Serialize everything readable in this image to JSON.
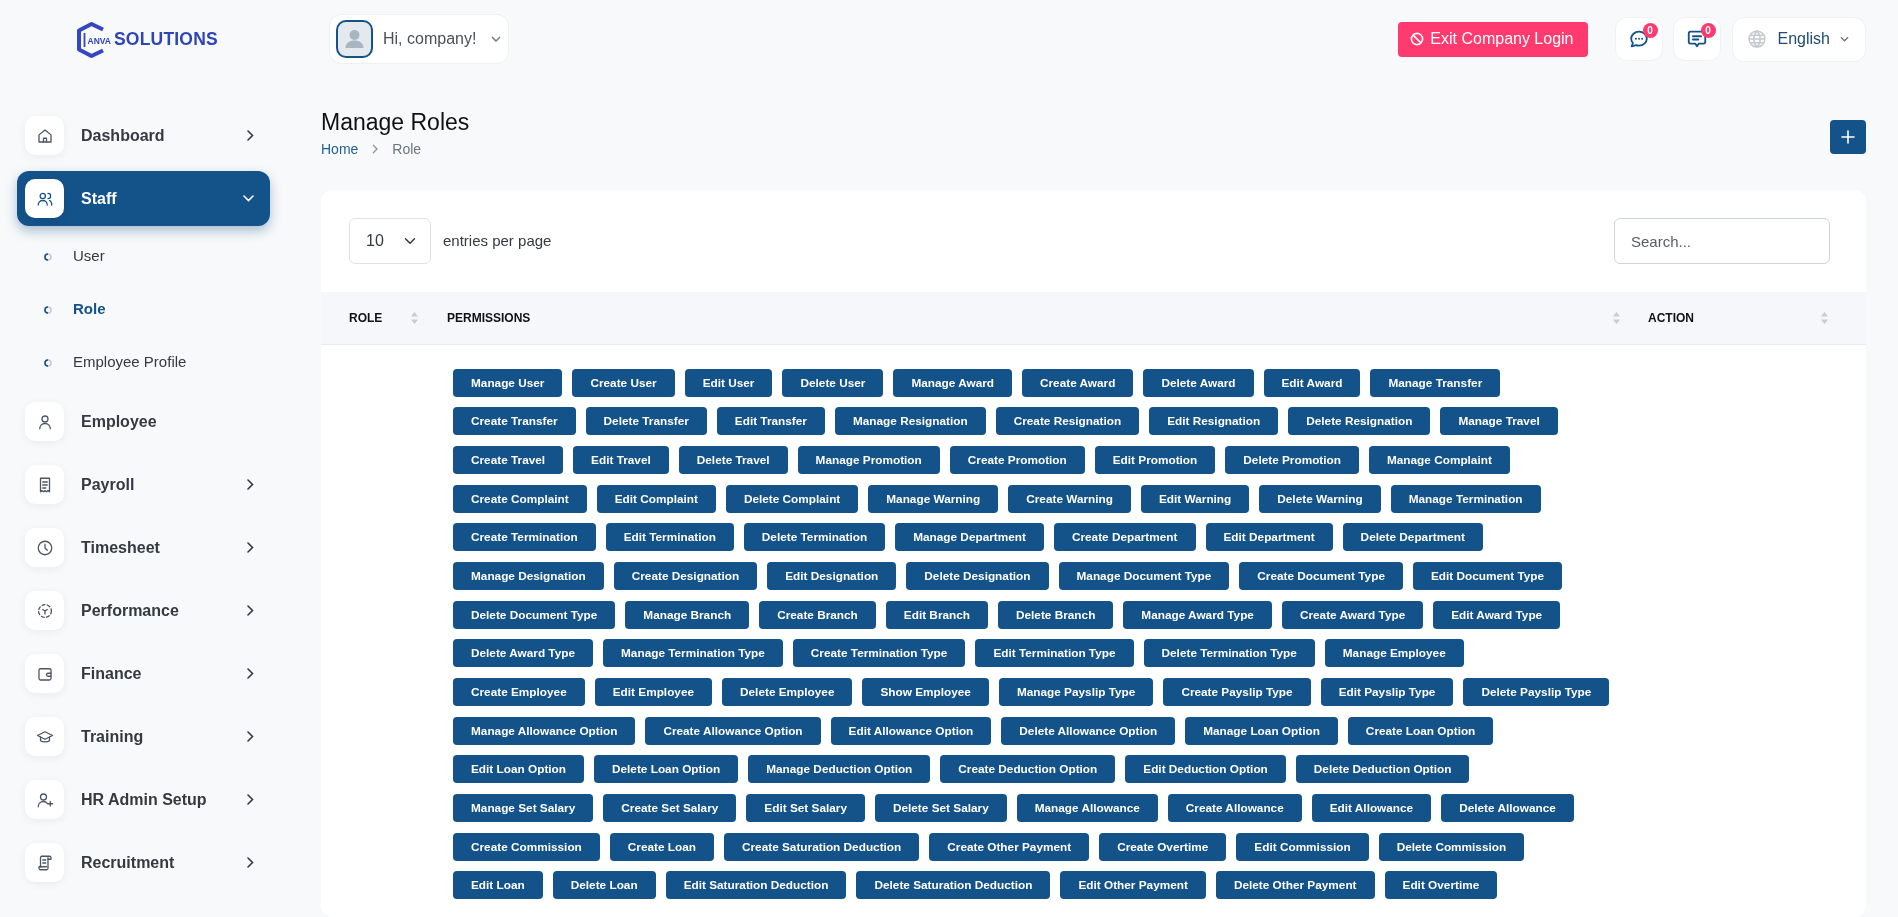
{
  "brand": {
    "mark": "ANVA",
    "name": "SOLUTIONS"
  },
  "sidebar": {
    "items": [
      {
        "label": "Dashboard",
        "kind": "menu",
        "expanded": false,
        "selected": false
      },
      {
        "label": "Staff",
        "kind": "menu",
        "expanded": true,
        "selected": true,
        "children": [
          {
            "label": "User",
            "selected": false
          },
          {
            "label": "Role",
            "selected": true
          },
          {
            "label": "Employee Profile",
            "selected": false
          }
        ]
      },
      {
        "label": "Employee",
        "kind": "link",
        "selected": false
      },
      {
        "label": "Payroll",
        "kind": "menu",
        "expanded": false,
        "selected": false
      },
      {
        "label": "Timesheet",
        "kind": "menu",
        "expanded": false,
        "selected": false
      },
      {
        "label": "Performance",
        "kind": "menu",
        "expanded": false,
        "selected": false
      },
      {
        "label": "Finance",
        "kind": "menu",
        "expanded": false,
        "selected": false
      },
      {
        "label": "Training",
        "kind": "menu",
        "expanded": false,
        "selected": false
      },
      {
        "label": "HR Admin Setup",
        "kind": "menu",
        "expanded": false,
        "selected": false
      },
      {
        "label": "Recruitment",
        "kind": "menu",
        "expanded": false,
        "selected": false
      }
    ]
  },
  "topbar": {
    "greeting": "Hi, company!",
    "exit_button": "Exit Company Login",
    "messages_count": "0",
    "notifications_count": "0",
    "language": "English"
  },
  "page": {
    "title": "Manage Roles",
    "breadcrumb": [
      {
        "label": "Home",
        "active": false
      },
      {
        "label": "Role",
        "active": true
      }
    ]
  },
  "table": {
    "page_size": "10",
    "page_size_label": "entries per page",
    "search": {
      "placeholder": "Search..."
    },
    "columns": [
      {
        "label": "ROLE",
        "sortable": true
      },
      {
        "label": "PERMISSIONS",
        "sortable": true
      },
      {
        "label": "ACTION",
        "sortable": true
      }
    ],
    "rows": [
      {
        "permission_lines": [
          [
            "Manage User",
            "Create User",
            "Edit User",
            "Delete User",
            "Manage Award",
            "Create Award",
            "Delete Award",
            "Edit Award",
            "Manage Transfer"
          ],
          [
            "Create Transfer",
            "Delete Transfer",
            "Edit Transfer",
            "Manage Resignation",
            "Create Resignation",
            "Edit Resignation",
            "Delete Resignation",
            "Manage Travel"
          ],
          [
            "Create Travel",
            "Edit Travel",
            "Delete Travel",
            "Manage Promotion",
            "Create Promotion",
            "Edit Promotion",
            "Delete Promotion",
            "Manage Complaint"
          ],
          [
            "Create Complaint",
            "Edit Complaint",
            "Delete Complaint",
            "Manage Warning",
            "Create Warning",
            "Edit Warning",
            "Delete Warning",
            "Manage Termination"
          ],
          [
            "Create Termination",
            "Edit Termination",
            "Delete Termination",
            "Manage Department",
            "Create Department",
            "Edit Department",
            "Delete Department"
          ],
          [
            "Manage Designation",
            "Create Designation",
            "Edit Designation",
            "Delete Designation",
            "Manage Document Type",
            "Create Document Type",
            "Edit Document Type"
          ],
          [
            "Delete Document Type",
            "Manage Branch",
            "Create Branch",
            "Edit Branch",
            "Delete Branch",
            "Manage Award Type",
            "Create Award Type",
            "Edit Award Type"
          ],
          [
            "Delete Award Type",
            "Manage Termination Type",
            "Create Termination Type",
            "Edit Termination Type",
            "Delete Termination Type",
            "Manage Employee"
          ],
          [
            "Create Employee",
            "Edit Employee",
            "Delete Employee",
            "Show Employee",
            "Manage Payslip Type",
            "Create Payslip Type",
            "Edit Payslip Type",
            "Delete Payslip Type"
          ],
          [
            "Manage Allowance Option",
            "Create Allowance Option",
            "Edit Allowance Option",
            "Delete Allowance Option",
            "Manage Loan Option",
            "Create Loan Option"
          ],
          [
            "Edit Loan Option",
            "Delete Loan Option",
            "Manage Deduction Option",
            "Create Deduction Option",
            "Edit Deduction Option",
            "Delete Deduction Option"
          ],
          [
            "Manage Set Salary",
            "Create Set Salary",
            "Edit Set Salary",
            "Delete Set Salary",
            "Manage Allowance",
            "Create Allowance",
            "Edit Allowance",
            "Delete Allowance"
          ],
          [
            "Create Commission",
            "Create Loan",
            "Create Saturation Deduction",
            "Create Other Payment",
            "Create Overtime",
            "Edit Commission",
            "Delete Commission"
          ],
          [
            "Edit Loan",
            "Delete Loan",
            "Edit Saturation Deduction",
            "Delete Saturation Deduction",
            "Edit Other Payment",
            "Delete Other Payment",
            "Edit Overtime"
          ]
        ]
      }
    ]
  }
}
